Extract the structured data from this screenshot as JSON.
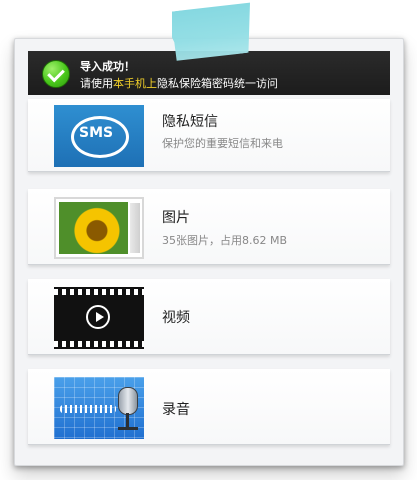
{
  "banner": {
    "title": "导入成功！",
    "message_prefix": "请使用",
    "message_highlight": "本手机上",
    "message_suffix": "隐私保险箱密码统一访问"
  },
  "items": [
    {
      "id": "sms",
      "title": "隐私短信",
      "subtitle": "保护您的重要短信和来电",
      "icon": "sms-icon",
      "icon_text": "SMS"
    },
    {
      "id": "photos",
      "title": "图片",
      "subtitle": "35张图片，占用8.62 MB",
      "icon": "photo-icon"
    },
    {
      "id": "videos",
      "title": "视频",
      "subtitle": "",
      "icon": "video-icon"
    },
    {
      "id": "audio",
      "title": "录音",
      "subtitle": "",
      "icon": "microphone-icon"
    }
  ],
  "colors": {
    "banner_bg": "#1f1f1f",
    "highlight": "#f2d02a",
    "check_green": "#49c71b"
  }
}
